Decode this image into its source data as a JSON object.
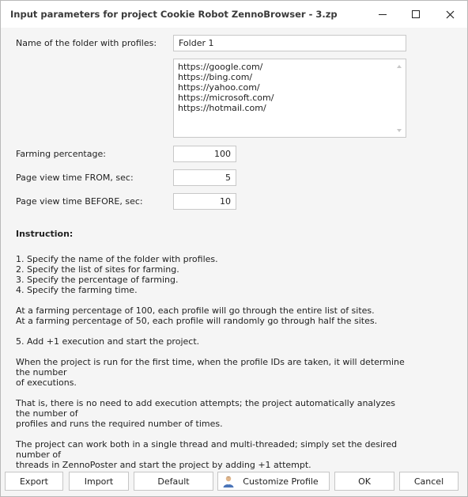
{
  "window": {
    "title": "Input parameters for project Cookie Robot ZennoBrowser - 3.zp"
  },
  "form": {
    "folder_label": "Name of the folder with profiles:",
    "folder_value": "Folder 1",
    "sites": [
      "https://google.com/",
      "https://bing.com/",
      "https://yahoo.com/",
      "https://microsoft.com/",
      "https://hotmail.com/"
    ],
    "farming_label": "Farming percentage:",
    "farming_value": "100",
    "from_label": "Page view time FROM, sec:",
    "from_value": "5",
    "before_label": "Page view time BEFORE, sec:",
    "before_value": "10"
  },
  "instruction": {
    "title": "Instruction:",
    "paragraphs": [
      [
        "1. Specify the name of the folder with profiles.",
        "2. Specify the list of sites for farming.",
        "3. Specify the percentage of farming.",
        "4. Specify the farming time."
      ],
      [
        "At a farming percentage of 100, each profile will go through the entire list of sites.",
        "At a farming percentage of 50, each profile will randomly go through half the sites."
      ],
      [
        "5. Add +1 execution and start the project."
      ],
      [
        "When the project is run for the first time, when the profile IDs are taken, it will determine the number",
        "of executions."
      ],
      [
        "That is, there is no need to add execution attempts; the project automatically analyzes the number of",
        "profiles and runs the required number of times."
      ],
      [
        "The project can work both in a single thread and multi-threaded; simply set the desired number of",
        "threads in ZennoPoster and start the project by adding +1 attempt."
      ]
    ]
  },
  "buttons": {
    "export": "Export",
    "import": "Import",
    "default": "Default",
    "customize_profile": "Customize Profile",
    "ok": "OK",
    "cancel": "Cancel"
  },
  "icons": {
    "minimize": "minimize-icon",
    "maximize": "maximize-icon",
    "close": "close-icon",
    "profile": "person-icon"
  },
  "colors": {
    "background": "#f5f5f5",
    "titlebar": "#ffffff",
    "border": "#c8c8c8"
  }
}
